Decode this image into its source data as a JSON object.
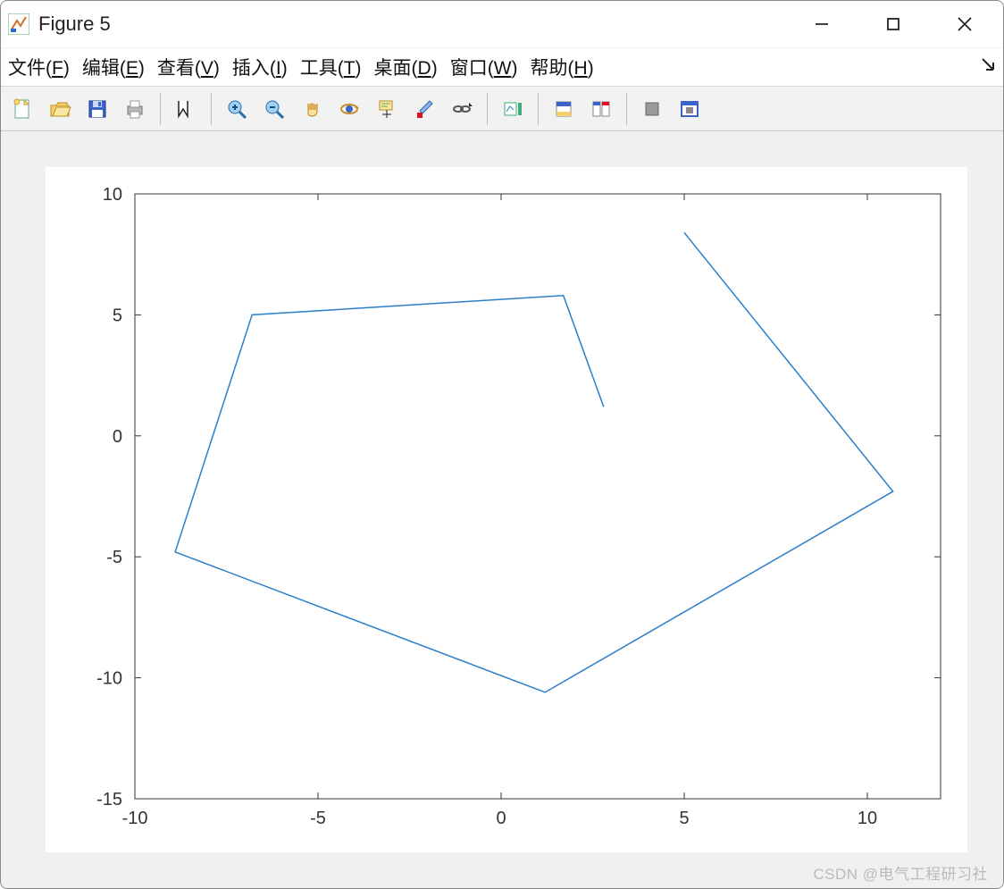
{
  "window": {
    "title": "Figure 5"
  },
  "menu": {
    "file": {
      "label": "文件",
      "key": "F"
    },
    "edit": {
      "label": "编辑",
      "key": "E"
    },
    "view": {
      "label": "查看",
      "key": "V"
    },
    "insert": {
      "label": "插入",
      "key": "I"
    },
    "tools": {
      "label": "工具",
      "key": "T"
    },
    "desktop": {
      "label": "桌面",
      "key": "D"
    },
    "window": {
      "label": "窗口",
      "key": "W"
    },
    "help": {
      "label": "帮助",
      "key": "H"
    }
  },
  "toolbar_icons": [
    "new-figure-icon",
    "open-icon",
    "save-icon",
    "print-icon",
    "sep",
    "edit-plot-icon",
    "sep",
    "zoom-in-icon",
    "zoom-out-icon",
    "pan-icon",
    "rotate-3d-icon",
    "data-cursor-icon",
    "brush-icon",
    "link-icon",
    "sep",
    "insert-colorbar-icon",
    "sep",
    "insert-legend-icon",
    "hide-plot-tools-icon",
    "sep",
    "axes-props-icon",
    "dock-figure-icon"
  ],
  "chart_data": {
    "type": "line",
    "x": [
      2.8,
      1.7,
      -6.8,
      -8.9,
      1.2,
      10.7,
      5.0
    ],
    "y": [
      1.2,
      5.8,
      5.0,
      -4.8,
      -10.6,
      -2.3,
      8.4
    ],
    "xlim": [
      -10,
      12
    ],
    "ylim": [
      -15,
      10
    ],
    "xticks": [
      -10,
      -5,
      0,
      5,
      10
    ],
    "yticks": [
      -15,
      -10,
      -5,
      0,
      5,
      10
    ],
    "line_color": "#2a7fc9",
    "title": "",
    "xlabel": "",
    "ylabel": ""
  },
  "watermark": "CSDN @电气工程研习社"
}
